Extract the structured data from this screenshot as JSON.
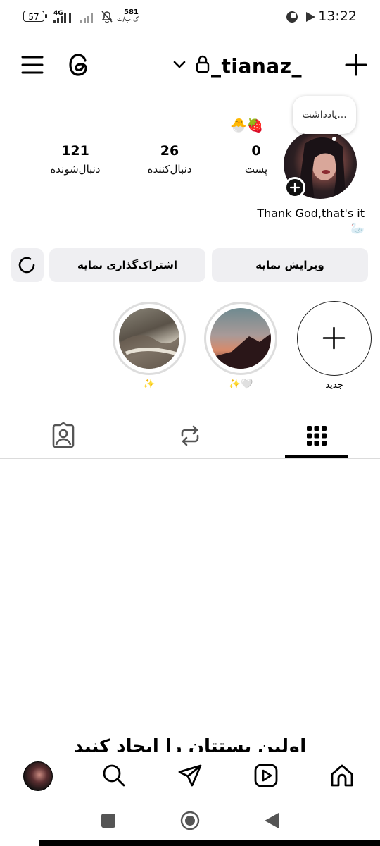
{
  "status_bar": {
    "battery": "57",
    "network": "4G",
    "speed": "581",
    "speed_unit": "ک.ب/ث",
    "time": "13:22"
  },
  "header": {
    "username": "_tianaz_",
    "icons": [
      "menu-icon",
      "threads-icon",
      "chevron-down-icon",
      "lock-icon",
      "plus-icon"
    ]
  },
  "profile": {
    "note_bubble": "یادداشت...",
    "note_emojis": "🐣🍓",
    "bio": "Thank God,that's it",
    "bio_emoji": "🦢",
    "stats": [
      {
        "value": "0",
        "label": "پست"
      },
      {
        "value": "26",
        "label": "دنبال‌کننده"
      },
      {
        "value": "121",
        "label": "دنبال‌شونده"
      }
    ]
  },
  "buttons": {
    "edit_profile": "ویرایش نمایه",
    "share_profile": "اشتراک‌گذاری نمایه"
  },
  "highlights": [
    {
      "label": "جدید"
    },
    {
      "label": "✨🤍"
    },
    {
      "label": "✨"
    }
  ],
  "tabs": [
    "grid-icon",
    "reposts-icon",
    "tagged-icon"
  ],
  "empty_state": "اولین پستتان را ایجاد کنید",
  "bottom_nav": [
    "home-icon",
    "reels-icon",
    "direct-icon",
    "search-icon",
    "profile-avatar"
  ],
  "colors": {
    "accent": "#000000",
    "button_bg": "#efeff2",
    "divider": "#dbdbdb"
  }
}
